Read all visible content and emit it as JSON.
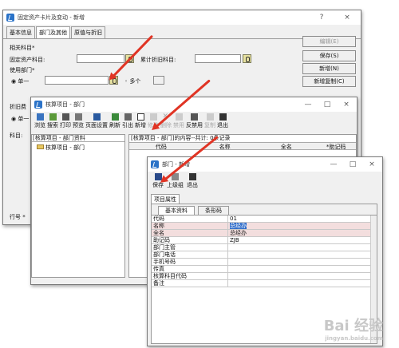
{
  "win1": {
    "title": "固定资产卡片及变动 - 新增",
    "help": "?",
    "close": "×",
    "tabs": [
      "基本信息",
      "部门及其他",
      "原值与折旧"
    ],
    "section": "相关科目*",
    "label_fa_account": "固定资产科目:",
    "label_dep_account": "累计折旧科目:",
    "label_dept": "使用部门*",
    "radio_single": "单一",
    "radio_multi": "多个",
    "section2": "折旧费",
    "radio_single2": "单一",
    "label_account2": "科目:",
    "label_bottom": "行号 *",
    "buttons": [
      "编辑(E)",
      "保存(S)",
      "新增(N)",
      "新增复制(C)"
    ]
  },
  "win2": {
    "title": "核算项目 - 部门",
    "min": "—",
    "max": "□",
    "close": "×",
    "toolbar": [
      "浏览",
      "搜索",
      "打印",
      "预览",
      "页面设置",
      "刷新",
      "引出",
      "新增",
      "修改",
      "删除",
      "禁用",
      "反禁用",
      "复制",
      "退出"
    ],
    "left_header": "[核算项目 - 部门资料",
    "tree_root": "核算项目 - 部门",
    "right_header": "[核算项目 - 部门]的内容--共计: 0条记录",
    "cols": [
      "代码",
      "名称",
      "全名",
      "*助记码"
    ]
  },
  "win3": {
    "title": "部门 - 新增",
    "min": "—",
    "max": "□",
    "close": "×",
    "toolbar": [
      "保存",
      "上级组",
      "退出"
    ],
    "tab": "项目属性",
    "subtabs": [
      "基本资料",
      "条形码"
    ],
    "rows": [
      {
        "k": "代码",
        "v": "01"
      },
      {
        "k": "名称",
        "v": "总经办"
      },
      {
        "k": "全名",
        "v": "总经办"
      },
      {
        "k": "助记码",
        "v": "ZJB"
      },
      {
        "k": "部门主管",
        "v": ""
      },
      {
        "k": "部门电话",
        "v": ""
      },
      {
        "k": "手机号码",
        "v": ""
      },
      {
        "k": "传真",
        "v": ""
      },
      {
        "k": "核算科目代码",
        "v": ""
      },
      {
        "k": "备注",
        "v": ""
      }
    ]
  },
  "watermark": {
    "brand": "Bai 经验",
    "url": "jingyan.baidu.com"
  }
}
